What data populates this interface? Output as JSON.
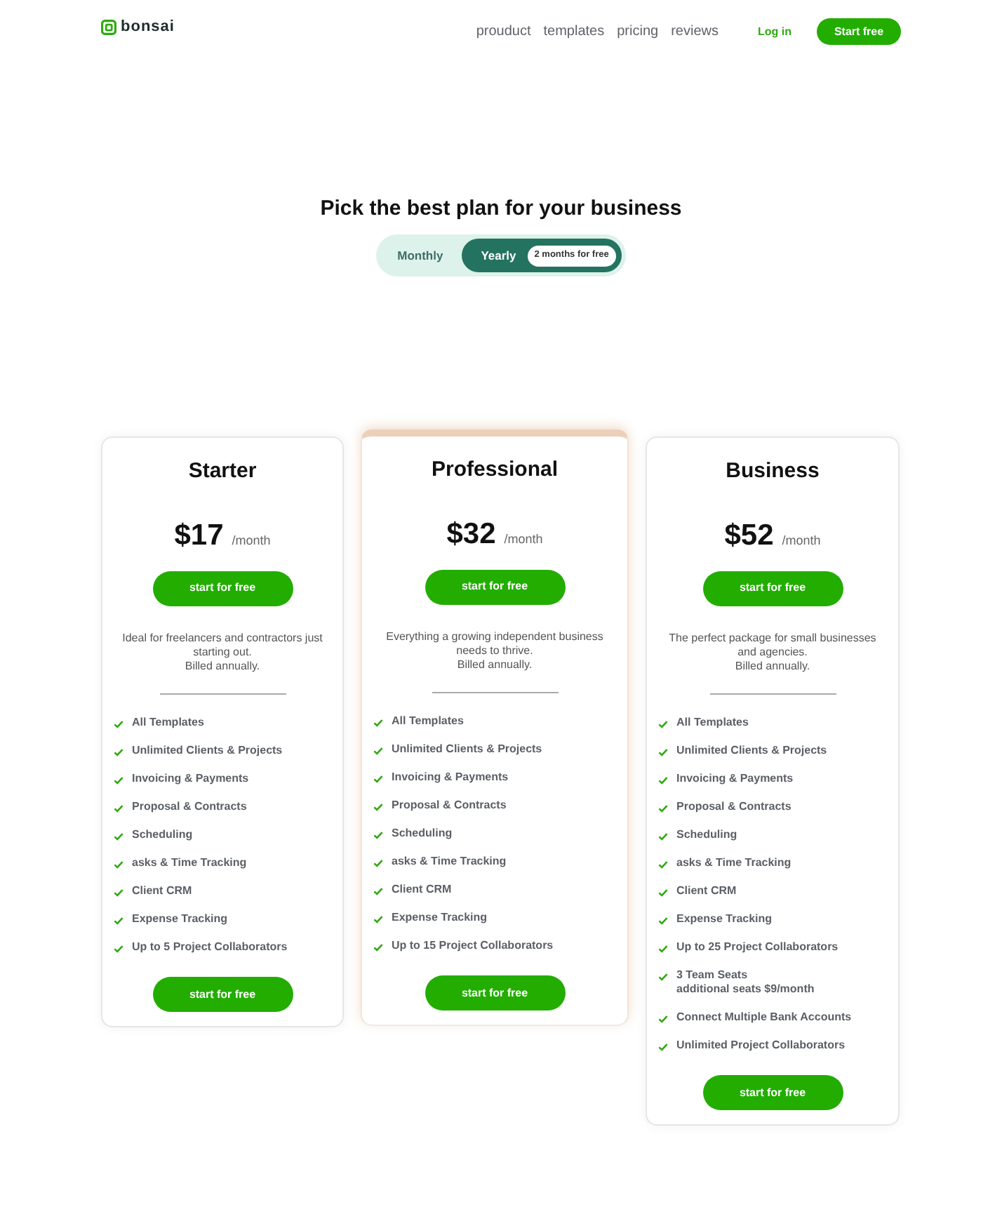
{
  "header": {
    "logo": "bonsai",
    "nav": [
      "prouduct",
      "templates",
      "pricing",
      "reviews"
    ],
    "login": "Log in",
    "cta": "Start free"
  },
  "pricing": {
    "title": "Pick the best plan for your business",
    "billing_toggle": [
      {
        "label": "Monthly",
        "selected": false
      },
      {
        "label": "Yearly",
        "selected": true,
        "badge": "2 months for free"
      }
    ]
  },
  "plans": [
    {
      "name": "Starter",
      "featured": false,
      "price": "$17",
      "period": "/month",
      "button": "start for free",
      "description": "Ideal for freelancers and contractors just starting out.",
      "billing_note": "Billed annually.",
      "features": [
        {
          "text": "All Templates"
        },
        {
          "text": "Unlimited Clients & Projects"
        },
        {
          "text": "Invoicing & Payments"
        },
        {
          "text": "Proposal & Contracts"
        },
        {
          "text": "Scheduling"
        },
        {
          "text": "asks & Time Tracking"
        },
        {
          "text": "Client CRM"
        },
        {
          "text": "Expense Tracking"
        },
        {
          "text": "Up to 5 Project Collaborators"
        }
      ],
      "bottom_button": "start for free"
    },
    {
      "name": "Professional",
      "featured": true,
      "price": "$32",
      "period": "/month",
      "button": "start for free",
      "description": "Everything a growing independent business needs to thrive.",
      "billing_note": "Billed annually.",
      "features": [
        {
          "text": "All Templates"
        },
        {
          "text": "Unlimited Clients & Projects"
        },
        {
          "text": "Invoicing & Payments"
        },
        {
          "text": "Proposal & Contracts"
        },
        {
          "text": "Scheduling"
        },
        {
          "text": "asks & Time Tracking"
        },
        {
          "text": "Client CRM"
        },
        {
          "text": "Expense Tracking"
        },
        {
          "text": "Up to 15 Project Collaborators"
        }
      ],
      "bottom_button": "start for free"
    },
    {
      "name": "Business",
      "featured": false,
      "price": "$52",
      "period": "/month",
      "button": "start for free",
      "description": "The perfect package for small businesses and agencies.",
      "billing_note": "Billed annually.",
      "features": [
        {
          "text": "All Templates"
        },
        {
          "text": "Unlimited Clients & Projects"
        },
        {
          "text": "Invoicing & Payments"
        },
        {
          "text": "Proposal & Contracts"
        },
        {
          "text": "Scheduling"
        },
        {
          "text": "asks & Time Tracking"
        },
        {
          "text": "Client CRM"
        },
        {
          "text": "Expense Tracking"
        },
        {
          "text": "Up to 25 Project Collaborators"
        },
        {
          "text": "3 Team Seats",
          "detail": "additional seats $9/month"
        },
        {
          "text": "Connect Multiple Bank Accounts"
        },
        {
          "text": "Unlimited Project Collaborators"
        }
      ],
      "bottom_button": "start for free"
    }
  ]
}
